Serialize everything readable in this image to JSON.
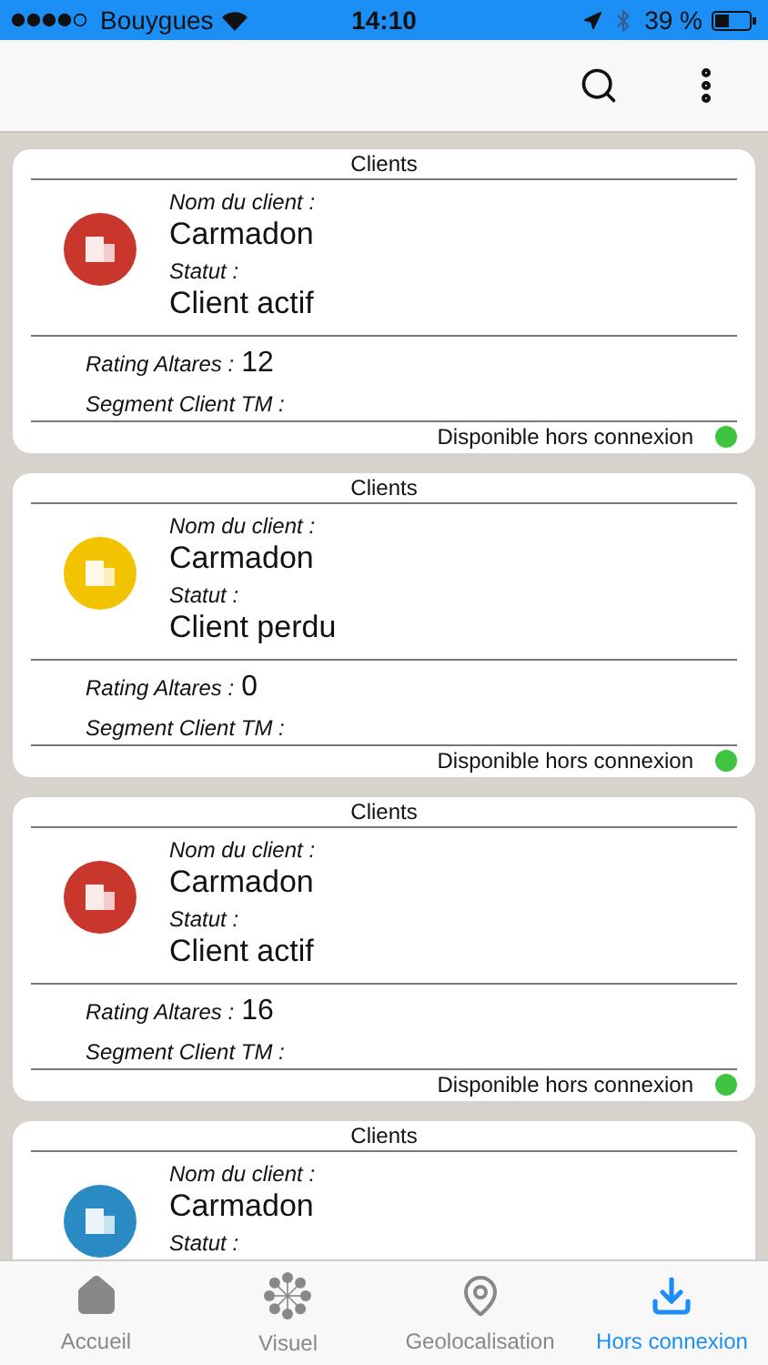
{
  "status_bar": {
    "carrier": "Bouygues",
    "time": "14:10",
    "battery": "39 %"
  },
  "cards": [
    {
      "title": "Clients",
      "color": "#c8362c",
      "name_label": "Nom du client :",
      "name": "Carmadon",
      "status_label": "Statut :",
      "status": "Client actif",
      "rating_label": "Rating Altares :",
      "rating": "12",
      "segment_label": "Segment Client TM :",
      "offline": "Disponible hors connexion"
    },
    {
      "title": "Clients",
      "color": "#f2c300",
      "name_label": "Nom du client :",
      "name": "Carmadon",
      "status_label": "Statut :",
      "status": "Client perdu",
      "rating_label": "Rating Altares :",
      "rating": "0",
      "segment_label": "Segment Client TM :",
      "offline": "Disponible hors connexion"
    },
    {
      "title": "Clients",
      "color": "#c8362c",
      "name_label": "Nom du client :",
      "name": "Carmadon",
      "status_label": "Statut :",
      "status": "Client actif",
      "rating_label": "Rating Altares :",
      "rating": "16",
      "segment_label": "Segment Client TM :",
      "offline": "Disponible hors connexion"
    },
    {
      "title": "Clients",
      "color": "#2a8bc4",
      "name_label": "Nom du client :",
      "name": "Carmadon",
      "status_label": "Statut :"
    }
  ],
  "tabs": [
    {
      "label": "Accueil",
      "selected": false
    },
    {
      "label": "Visuel",
      "selected": false
    },
    {
      "label": "Geolocalisation",
      "selected": false
    },
    {
      "label": "Hors connexion",
      "selected": true
    }
  ]
}
